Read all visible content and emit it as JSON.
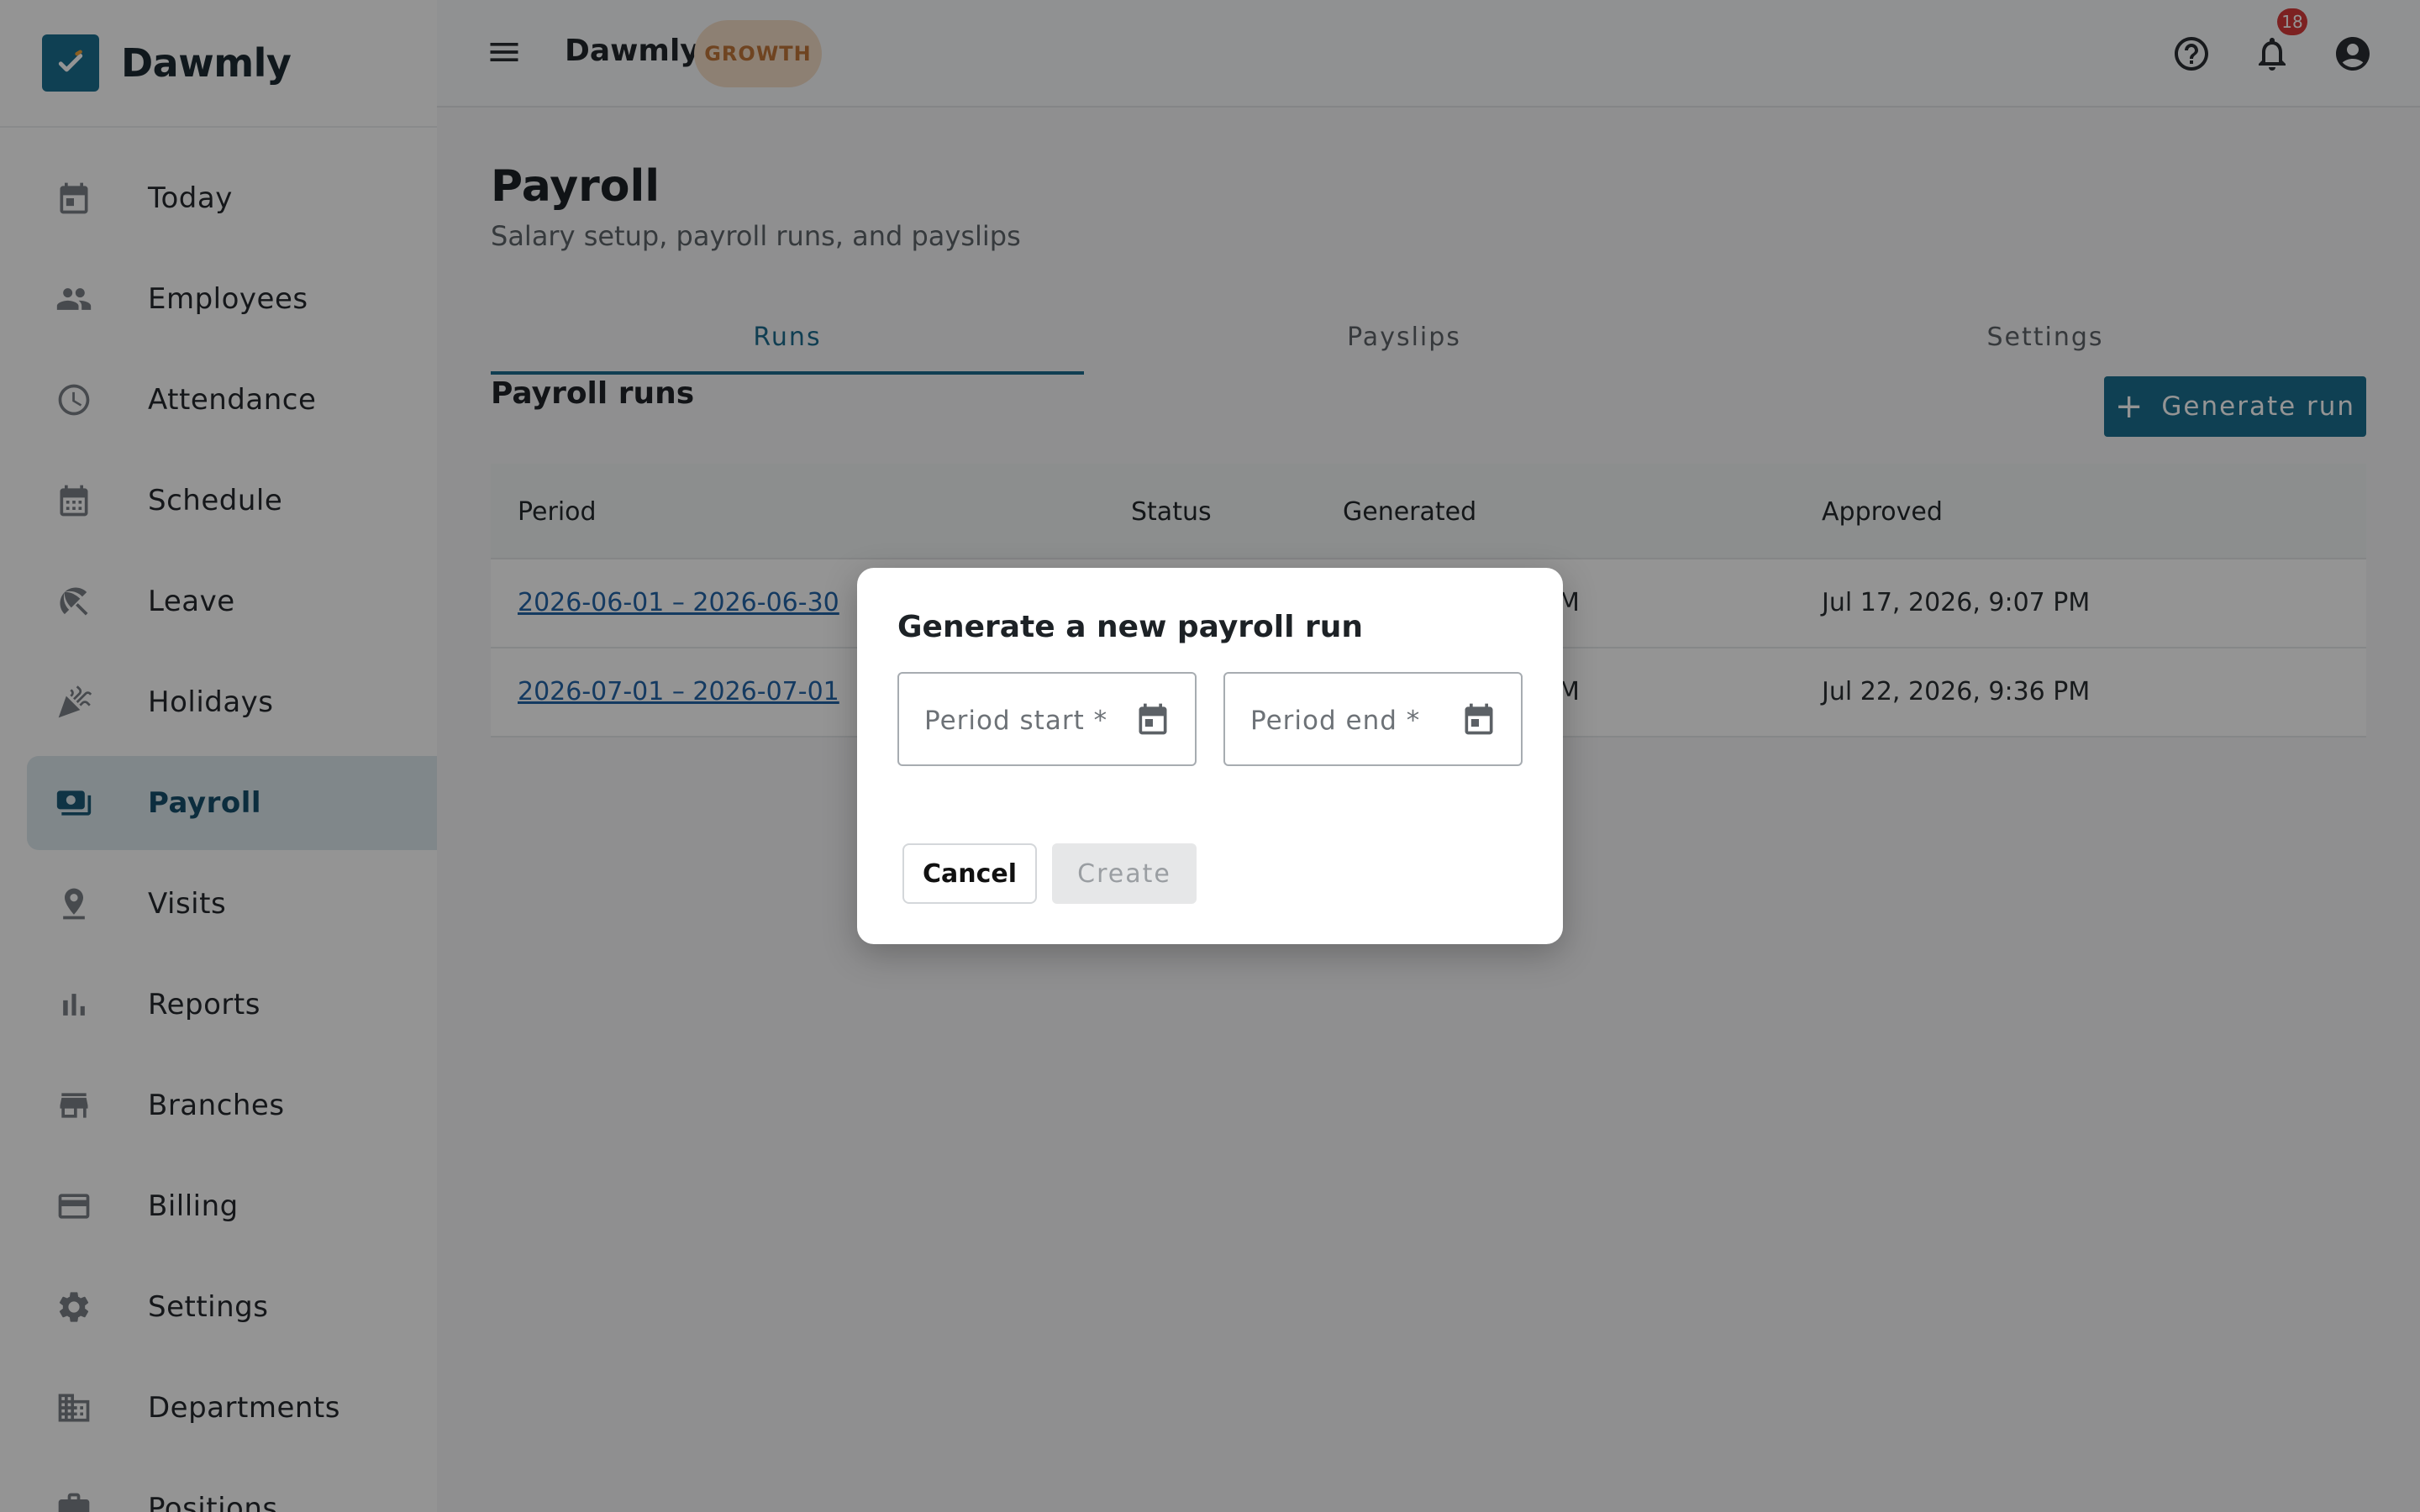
{
  "brand": {
    "name": "Dawmly",
    "accent": "#1b6e8f"
  },
  "sidebar": {
    "items": [
      {
        "label": "Today",
        "icon": "calendar-today-icon"
      },
      {
        "label": "Employees",
        "icon": "people-icon"
      },
      {
        "label": "Attendance",
        "icon": "clock-icon"
      },
      {
        "label": "Schedule",
        "icon": "calendar-grid-icon"
      },
      {
        "label": "Leave",
        "icon": "beach-umbrella-icon"
      },
      {
        "label": "Holidays",
        "icon": "celebration-icon"
      },
      {
        "label": "Payroll",
        "icon": "payments-icon",
        "active": true
      },
      {
        "label": "Visits",
        "icon": "location-pin-icon"
      },
      {
        "label": "Reports",
        "icon": "bar-chart-icon"
      },
      {
        "label": "Branches",
        "icon": "store-icon"
      },
      {
        "label": "Billing",
        "icon": "credit-card-icon"
      },
      {
        "label": "Settings",
        "icon": "gear-icon"
      },
      {
        "label": "Departments",
        "icon": "building-icon"
      },
      {
        "label": "Positions",
        "icon": "briefcase-icon"
      }
    ]
  },
  "topbar": {
    "title": "Dawmly",
    "plan_badge": "GROWTH",
    "notification_count": "18"
  },
  "page": {
    "title": "Payroll",
    "subtitle": "Salary setup, payroll runs, and payslips"
  },
  "tabs": [
    {
      "label": "Runs",
      "active": true
    },
    {
      "label": "Payslips"
    },
    {
      "label": "Settings"
    }
  ],
  "section": {
    "title": "Payroll runs",
    "generate_label": "Generate run"
  },
  "table": {
    "columns": [
      "Period",
      "Status",
      "Generated",
      "Approved"
    ],
    "rows": [
      {
        "period": "2026-06-01 – 2026-06-30",
        "generated_visible": "M",
        "approved": "Jul 17, 2026, 9:07 PM"
      },
      {
        "period": "2026-07-01 – 2026-07-01",
        "generated_visible": "M",
        "approved": "Jul 22, 2026, 9:36 PM"
      }
    ]
  },
  "dialog": {
    "title": "Generate a new payroll run",
    "start_placeholder": "Period start *",
    "end_placeholder": "Period end *",
    "cancel_label": "Cancel",
    "create_label": "Create"
  }
}
